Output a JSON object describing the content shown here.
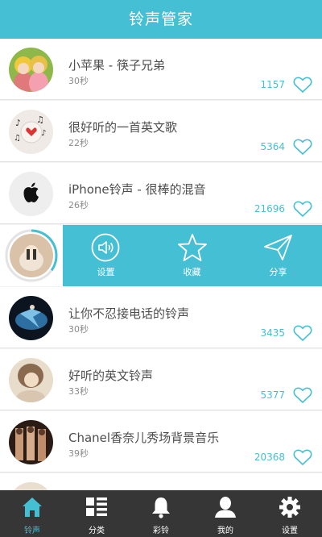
{
  "header": {
    "title": "铃声管家"
  },
  "songs": [
    {
      "title": "小苹果 - 筷子兄弟",
      "duration": "30秒",
      "count": "1157",
      "avatar_icon": "two-people-photo"
    },
    {
      "title": "很好听的一首英文歌",
      "duration": "22秒",
      "count": "5364",
      "avatar_icon": "music-notes-photo"
    },
    {
      "title": "iPhone铃声 - 很棒的混音",
      "duration": "26秒",
      "count": "21696",
      "avatar_icon": "apple-logo"
    },
    {
      "title": "让你不忍接电话的铃声",
      "duration": "30秒",
      "count": "3435",
      "avatar_icon": "dancer-photo"
    },
    {
      "title": "好听的英文铃声",
      "duration": "33秒",
      "count": "5377",
      "avatar_icon": "girl-portrait-photo"
    },
    {
      "title": "Chanel香奈儿秀场背景音乐",
      "duration": "39秒",
      "count": "20368",
      "avatar_icon": "fashion-show-photo"
    }
  ],
  "playing": {
    "progress": 0.35,
    "avatar_icon": "playing-photo"
  },
  "actions": [
    {
      "label": "设置",
      "icon": "speaker-icon"
    },
    {
      "label": "收藏",
      "icon": "star-icon"
    },
    {
      "label": "分享",
      "icon": "send-icon"
    }
  ],
  "tabs": [
    {
      "label": "铃声",
      "icon": "home-icon",
      "active": true
    },
    {
      "label": "分类",
      "icon": "grid-list-icon",
      "active": false
    },
    {
      "label": "彩铃",
      "icon": "bell-icon",
      "active": false
    },
    {
      "label": "我的",
      "icon": "person-icon",
      "active": false
    },
    {
      "label": "设置",
      "icon": "gear-icon",
      "active": false
    }
  ],
  "colors": {
    "accent": "#45bfd4",
    "tabbar": "#363636"
  }
}
